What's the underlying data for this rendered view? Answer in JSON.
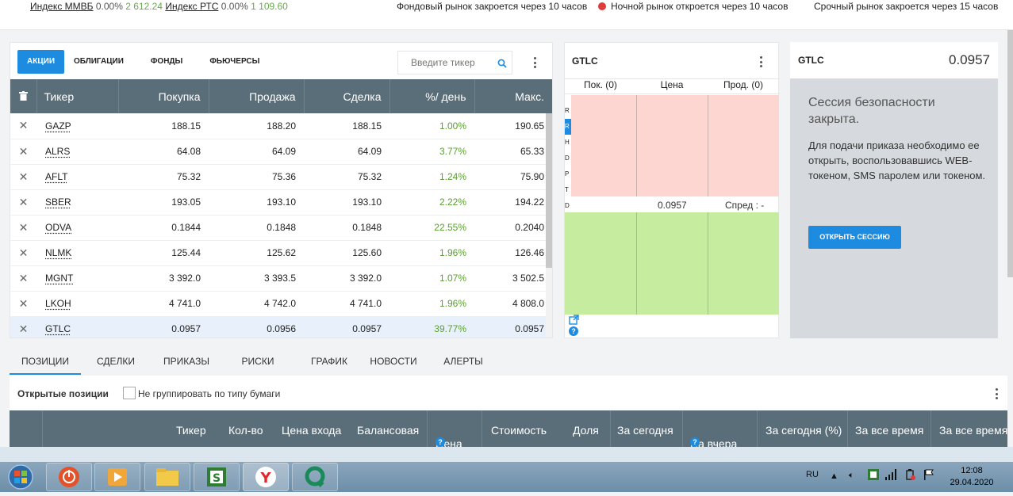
{
  "topbar": {
    "idx1_name": "Индекс ММВБ",
    "idx1_pct": "0.00%",
    "idx1_val": "2 612.24",
    "idx2_name": "Индекс РТС",
    "idx2_pct": "0.00%",
    "idx2_val": "1 109.60",
    "market_stock": "Фондовый рынок закроется через 10 часов",
    "market_night": "Ночной рынок откроется через 10 часов",
    "market_futures": "Срочный рынок закроется через 15 часов",
    "night_dot_color": "#e03a3a"
  },
  "watchlist": {
    "tabs": [
      "АКЦИИ",
      "ОБЛИГАЦИИ",
      "ФОНДЫ",
      "ФЬЮЧЕРСЫ"
    ],
    "search_placeholder": "Введите тикер",
    "columns": [
      "Тикер",
      "Покупка",
      "Продажа",
      "Сделка",
      "%/ день",
      "Макс."
    ],
    "rows": [
      {
        "ticker": "GAZP",
        "bid": "188.15",
        "ask": "188.20",
        "last": "188.15",
        "chg": "1.00%",
        "max": "190.65"
      },
      {
        "ticker": "ALRS",
        "bid": "64.08",
        "ask": "64.09",
        "last": "64.09",
        "chg": "3.77%",
        "max": "65.33"
      },
      {
        "ticker": "AFLT",
        "bid": "75.32",
        "ask": "75.36",
        "last": "75.32",
        "chg": "1.24%",
        "max": "75.90"
      },
      {
        "ticker": "SBER",
        "bid": "193.05",
        "ask": "193.10",
        "last": "193.10",
        "chg": "2.22%",
        "max": "194.22"
      },
      {
        "ticker": "ODVA",
        "bid": "0.1844",
        "ask": "0.1848",
        "last": "0.1848",
        "chg": "22.55%",
        "max": "0.2040"
      },
      {
        "ticker": "NLMK",
        "bid": "125.44",
        "ask": "125.62",
        "last": "125.60",
        "chg": "1.96%",
        "max": "126.46"
      },
      {
        "ticker": "MGNT",
        "bid": "3 392.0",
        "ask": "3 393.5",
        "last": "3 392.0",
        "chg": "1.07%",
        "max": "3 502.5"
      },
      {
        "ticker": "LKOH",
        "bid": "4 741.0",
        "ask": "4 742.0",
        "last": "4 741.0",
        "chg": "1.96%",
        "max": "4 808.0"
      },
      {
        "ticker": "GTLC",
        "bid": "0.0957",
        "ask": "0.0956",
        "last": "0.0957",
        "chg": "39.77%",
        "max": "0.0957"
      }
    ],
    "selected_row": 8,
    "change_color": "#5aa02c"
  },
  "orderbook": {
    "title": "GTLC",
    "col_buy": "Пок. (0)",
    "col_price": "Цена",
    "col_sell": "Прод. (0)",
    "letters": [
      "R",
      "R",
      "H",
      "D",
      "P",
      "T",
      "D"
    ],
    "mid_price": "0.0957",
    "spread": "Спред : -"
  },
  "session": {
    "ticker": "GTLC",
    "price": "0.0957",
    "heading": "Сессия безопасности закрыта.",
    "text": "Для подачи приказа необходимо ее открыть, воспользовавшись WEB-токеном, SMS паролем или токеном.",
    "button": "ОТКРЫТЬ СЕССИЮ"
  },
  "bottom": {
    "tabs": [
      "ПОЗИЦИИ",
      "СДЕЛКИ",
      "ПРИКАЗЫ",
      "РИСКИ",
      "ГРАФИК",
      "НОВОСТИ",
      "АЛЕРТЫ"
    ],
    "open_positions": "Открытые позиции",
    "no_group": "Не группировать по типу бумаги",
    "columns": [
      "Тикер",
      "Кол-во",
      "Цена входа",
      "Балансовая",
      "Цена",
      "Стоимость",
      "Доля",
      "За сегодня",
      "На вчера",
      "За сегодня (%)",
      "За все время",
      "За все время"
    ]
  },
  "taskbar": {
    "lang": "RU",
    "time": "12:08",
    "date": "29.04.2020",
    "apps": [
      "power-app",
      "media-player",
      "file-explorer",
      "s-app",
      "yandex-browser",
      "q-app"
    ]
  },
  "colors": {
    "accent": "#1d8ce0",
    "header_bg": "#5a6e7a",
    "bid_area": "#fdd6d2",
    "ask_area": "#c6ec9f"
  }
}
